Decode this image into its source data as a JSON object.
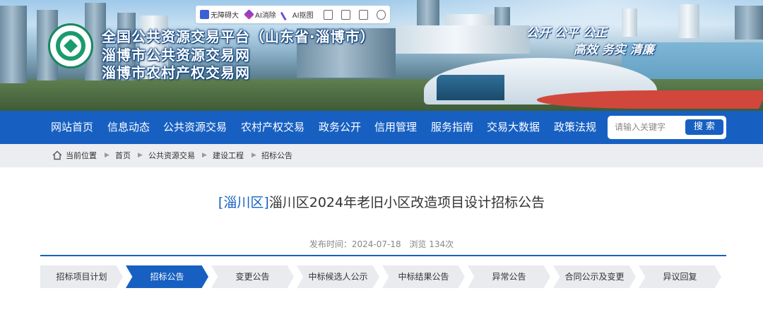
{
  "toolbar": {
    "items": [
      {
        "label": "无障碍大",
        "icon": "zoom-icon"
      },
      {
        "label": "AI消除",
        "icon": "eraser-icon"
      },
      {
        "label": "AI抠图",
        "icon": "cutout-icon"
      }
    ],
    "extra_icons": [
      "screenshot-icon",
      "crop-icon",
      "download-icon",
      "settings-icon"
    ]
  },
  "banner": {
    "title_line1": "全国公共资源交易平台（山东省·淄博市）",
    "title_line2": "淄博市公共资源交易网",
    "title_line3": "淄博市农村产权交易网",
    "slogan_line1": "公开 公平 公正",
    "slogan_line2": "高效 务实 清廉"
  },
  "nav": {
    "items": [
      "网站首页",
      "信息动态",
      "公共资源交易",
      "农村产权交易",
      "政务公开",
      "信用管理",
      "服务指南",
      "交易大数据",
      "政策法规"
    ],
    "search_placeholder": "请输入关键字",
    "search_button": "搜 索"
  },
  "breadcrumb": {
    "current_label": "当前位置",
    "items": [
      "首页",
      "公共资源交易",
      "建设工程",
      "招标公告"
    ]
  },
  "article": {
    "region": "[淄川区]",
    "title": "淄川区2024年老旧小区改造项目设计招标公告",
    "publish_label": "发布时间：2024-07-18",
    "views_label": "浏览 134次"
  },
  "tabs": {
    "items": [
      "招标项目计划",
      "招标公告",
      "变更公告",
      "中标候选人公示",
      "中标结果公告",
      "异常公告",
      "合同公示及变更",
      "异议回复"
    ],
    "active_index": 1
  },
  "colors": {
    "primary": "#1760c2",
    "breadcrumb_bg": "#ebedf0",
    "tab_bg": "#e9ebef"
  }
}
